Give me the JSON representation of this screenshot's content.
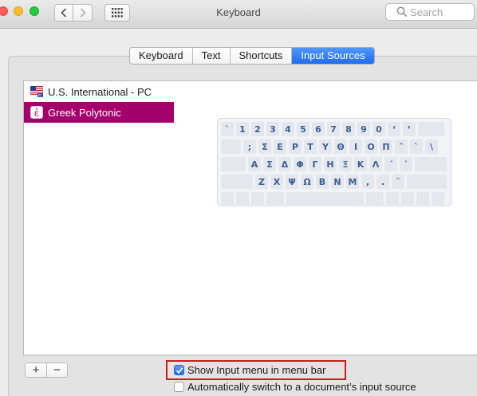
{
  "window": {
    "title": "Keyboard"
  },
  "search": {
    "placeholder": "Search"
  },
  "tabs": [
    {
      "label": "Keyboard",
      "active": false
    },
    {
      "label": "Text",
      "active": false
    },
    {
      "label": "Shortcuts",
      "active": false
    },
    {
      "label": "Input Sources",
      "active": true
    }
  ],
  "sources": [
    {
      "label": "U.S. International - PC",
      "icon": "us-flag-icon",
      "selected": false
    },
    {
      "label": "Greek Polytonic",
      "icon": "greek-polytonic-icon",
      "icon_glyph": "ἐ",
      "selected": true
    }
  ],
  "keyboard_rows": [
    [
      "`",
      "1",
      "2",
      "3",
      "4",
      "5",
      "6",
      "7",
      "8",
      "9",
      "0",
      "ʻ",
      "ʼ"
    ],
    [
      ";",
      "Σ",
      "Ε",
      "Ρ",
      "Τ",
      "Υ",
      "Θ",
      "Ι",
      "Ο",
      "Π",
      "ˆ",
      "`",
      "\\"
    ],
    [
      "Α",
      "Σ",
      "Δ",
      "Φ",
      "Γ",
      "Η",
      "Ξ",
      "Κ",
      "Λ",
      "´",
      "ʹ"
    ],
    [
      "Ζ",
      "Χ",
      "Ψ",
      "Ω",
      "Β",
      "Ν",
      "Μ",
      ",",
      ".",
      "˘"
    ]
  ],
  "buttons": {
    "add": "+",
    "remove": "−"
  },
  "options": {
    "show_input_menu": {
      "label": "Show Input menu in menu bar",
      "checked": true
    },
    "auto_switch": {
      "label": "Automatically switch to a document’s input source",
      "checked": false
    }
  },
  "colors": {
    "selection": "#a4006b",
    "accent": "#1f6cf1",
    "highlight_box": "#d31a1a"
  }
}
